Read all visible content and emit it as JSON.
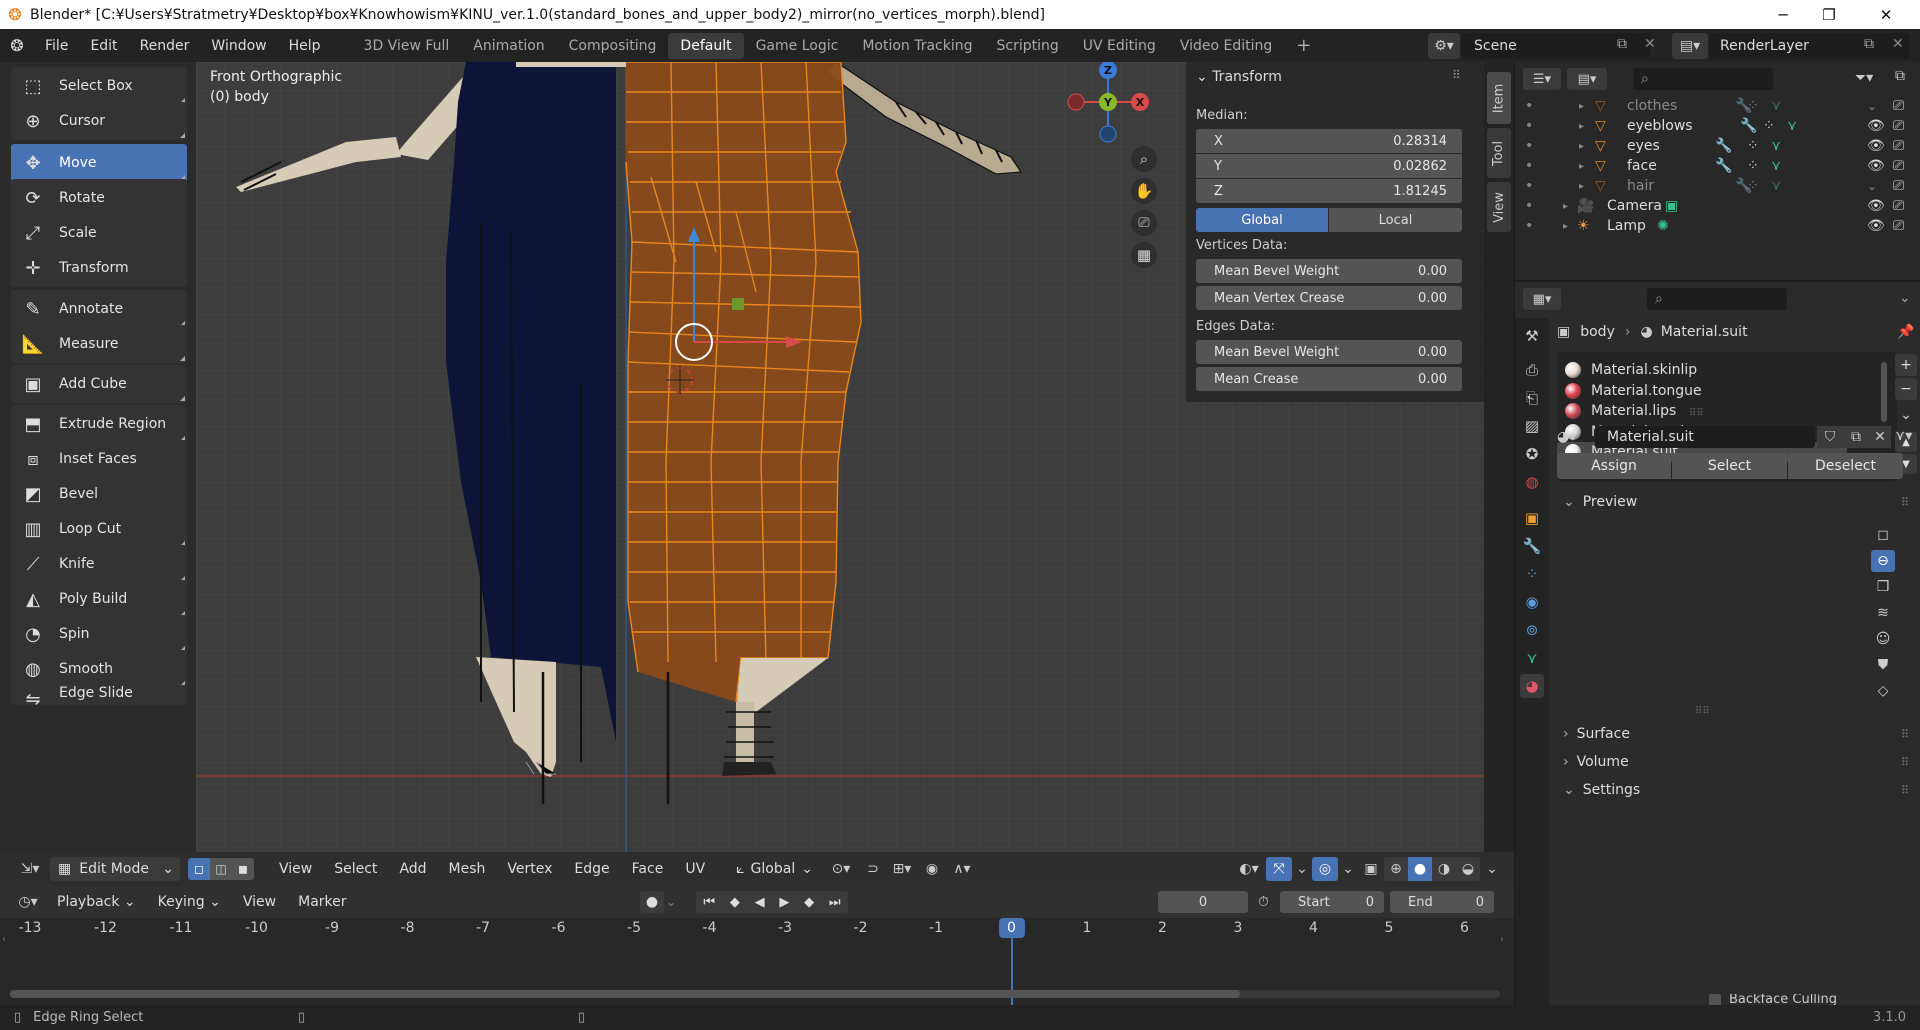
{
  "window": {
    "title": "Blender* [C:¥Users¥Stratmetry¥Desktop¥box¥Knowhowism¥KINU_ver.1.0(standard_bones_and_upper_body2)_mirror(no_vertices_morph).blend]",
    "minimize": "─",
    "maximize": "❐",
    "close": "✕"
  },
  "menu": {
    "items": [
      "File",
      "Edit",
      "Render",
      "Window",
      "Help"
    ],
    "workspaces": [
      "3D View Full",
      "Animation",
      "Compositing",
      "Default",
      "Game Logic",
      "Motion Tracking",
      "Scripting",
      "UV Editing",
      "Video Editing"
    ],
    "active_workspace": "Default",
    "add_tab": "+",
    "scene_label": "Scene",
    "renderlayer_label": "RenderLayer"
  },
  "toolbar": {
    "tools": [
      {
        "label": "Select Box",
        "icon": "select-box-icon",
        "glyph": "⬚"
      },
      {
        "label": "Cursor",
        "icon": "cursor-icon",
        "glyph": "⊕"
      },
      {
        "label": "Move",
        "icon": "move-icon",
        "glyph": "✥",
        "active": true
      },
      {
        "label": "Rotate",
        "icon": "rotate-icon",
        "glyph": "⟳"
      },
      {
        "label": "Scale",
        "icon": "scale-icon",
        "glyph": "⤢"
      },
      {
        "label": "Transform",
        "icon": "transform-icon",
        "glyph": "✛"
      },
      {
        "label": "Annotate",
        "icon": "annotate-icon",
        "glyph": "✎"
      },
      {
        "label": "Measure",
        "icon": "measure-icon",
        "glyph": "📐"
      },
      {
        "label": "Add Cube",
        "icon": "add-cube-icon",
        "glyph": "▣"
      },
      {
        "label": "Extrude Region",
        "icon": "extrude-region-icon",
        "glyph": "⬒"
      },
      {
        "label": "Inset Faces",
        "icon": "inset-faces-icon",
        "glyph": "⧈"
      },
      {
        "label": "Bevel",
        "icon": "bevel-icon",
        "glyph": "◩"
      },
      {
        "label": "Loop Cut",
        "icon": "loop-cut-icon",
        "glyph": "▥"
      },
      {
        "label": "Knife",
        "icon": "knife-icon",
        "glyph": "⟋"
      },
      {
        "label": "Poly Build",
        "icon": "poly-build-icon",
        "glyph": "◭"
      },
      {
        "label": "Spin",
        "icon": "spin-icon",
        "glyph": "◔"
      },
      {
        "label": "Smooth",
        "icon": "smooth-icon",
        "glyph": "◍"
      },
      {
        "label": "Edge Slide",
        "icon": "edge-slide-icon",
        "glyph": "⇋"
      }
    ]
  },
  "viewport": {
    "view_name": "Front Orthographic",
    "object_name": "(0) body",
    "gizmo": {
      "z": "Z",
      "y": "Y",
      "x": "X"
    }
  },
  "npanel": {
    "title": "Transform",
    "median_label": "Median:",
    "x_label": "X",
    "x_value": "0.28314",
    "y_label": "Y",
    "y_value": "0.02862",
    "z_label": "Z",
    "z_value": "1.81245",
    "global_label": "Global",
    "local_label": "Local",
    "vertices_data_label": "Vertices Data:",
    "mean_bevel_weight_label": "Mean Bevel Weight",
    "mean_bevel_weight_v": "0.00",
    "mean_vertex_crease_label": "Mean Vertex Crease",
    "mean_vertex_crease_v": "0.00",
    "edges_data_label": "Edges Data:",
    "edge_bevel_weight_label": "Mean Bevel Weight",
    "edge_bevel_weight_v": "0.00",
    "mean_crease_label": "Mean Crease",
    "mean_crease_v": "0.00"
  },
  "sidetabs": [
    "Item",
    "Tool",
    "View"
  ],
  "header3d": {
    "mode": "Edit Mode",
    "menus": [
      "View",
      "Select",
      "Add",
      "Mesh",
      "Vertex",
      "Edge",
      "Face",
      "UV"
    ],
    "orientation": "Global"
  },
  "timeline": {
    "menus": [
      "Playback",
      "Keying",
      "View",
      "Marker"
    ],
    "current_frame": "0",
    "start_label": "Start",
    "start_value": "0",
    "end_label": "End",
    "end_value": "0",
    "ticks": [
      "-13",
      "-12",
      "-11",
      "-10",
      "-9",
      "-8",
      "-7",
      "-6",
      "-5",
      "-4",
      "-3",
      "-2",
      "-1",
      "0",
      "1",
      "2",
      "3",
      "4",
      "5",
      "6"
    ],
    "playhead": "0"
  },
  "status": {
    "left_text": "Edge Ring Select",
    "version": "3.1.0"
  },
  "outliner": {
    "items": [
      {
        "name": "clothes",
        "icon": "mesh-icon",
        "dim": true
      },
      {
        "name": "eyeblows",
        "icon": "mesh-icon",
        "dim": false
      },
      {
        "name": "eyes",
        "icon": "mesh-icon",
        "dim": false
      },
      {
        "name": "face",
        "icon": "mesh-icon",
        "dim": false
      },
      {
        "name": "hair",
        "icon": "mesh-icon",
        "dim": true
      },
      {
        "name": "Camera",
        "icon": "camera-icon",
        "dim": false
      },
      {
        "name": "Lamp",
        "icon": "lamp-icon",
        "dim": false
      }
    ]
  },
  "properties": {
    "breadcrumb_object": "body",
    "breadcrumb_material": "Material.suit",
    "materials": [
      {
        "name": "Material.skinlip",
        "color": "#e8dcd0"
      },
      {
        "name": "Material.tongue",
        "color": "#e04050"
      },
      {
        "name": "Material.lips",
        "color": "#d04a55"
      },
      {
        "name": "Material.tooths",
        "color": "#d6d6d6"
      },
      {
        "name": "Material.suit",
        "color": "#f0f0f0",
        "selected": true
      }
    ],
    "material_field": "Material.suit",
    "assign": "Assign",
    "select": "Select",
    "deselect": "Deselect",
    "sections": [
      "Preview",
      "Surface",
      "Volume",
      "Settings"
    ],
    "backface": "Backface Culling"
  },
  "colors": {
    "accent": "#4772b3",
    "mesh_orange": "#e8871e",
    "suit_navy": "#0e1437",
    "skin": "#d6cbb6"
  }
}
